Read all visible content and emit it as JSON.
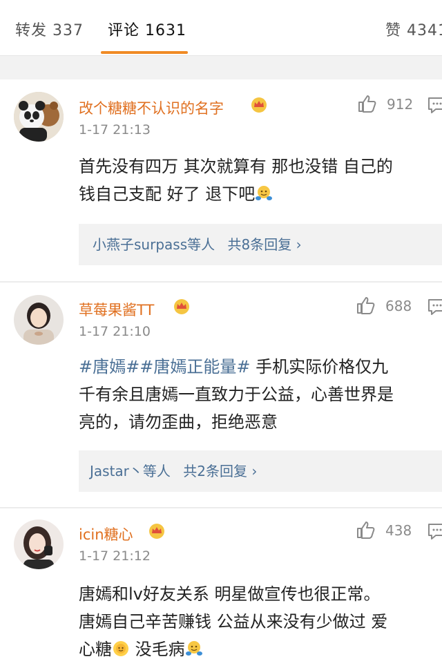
{
  "tabs": {
    "repost": "转发 337",
    "comment": "评论 1631",
    "likes": "赞 4341"
  },
  "comments": [
    {
      "username": "改个糖糖不认识的名字",
      "time": "1-17 21:13",
      "likes": "912",
      "lines": [
        "首先没有四万 其次就算有 那也没错 自己的",
        "钱自己支配 好了 退下吧"
      ],
      "replies_user": "小燕子surpass等人",
      "replies_count": "共8条回复",
      "avatar_icon": "panda-avatar"
    },
    {
      "username": "草莓果酱TT",
      "time": "1-17 21:10",
      "likes": "688",
      "hashtag1": "#唐嫣#",
      "hashtag2": "#唐嫣正能量#",
      "line1_rest": " 手机实际价格仅九",
      "line2": "千有余且唐嫣一直致力于公益，心善世界是",
      "line3": "亮的，请勿歪曲，拒绝恶意",
      "replies_user": "Jastar丶等人",
      "replies_count": "共2条回复",
      "avatar_icon": "girl-avatar"
    },
    {
      "username": "icin糖心",
      "time": "1-17 21:12",
      "likes": "438",
      "line1": "唐嫣和lv好友关系 明星做宣传也很正常。",
      "line2": "唐嫣自己辛苦赚钱 公益从来没有少做过 爱",
      "line3a": "心糖",
      "line3b": " 没毛病",
      "avatar_icon": "woman-avatar"
    }
  ],
  "colors": {
    "accent": "#f08a24",
    "username": "#e07020",
    "link": "#4a6f95",
    "gray": "#8a8a8a",
    "divider": "#f2f2f2"
  }
}
